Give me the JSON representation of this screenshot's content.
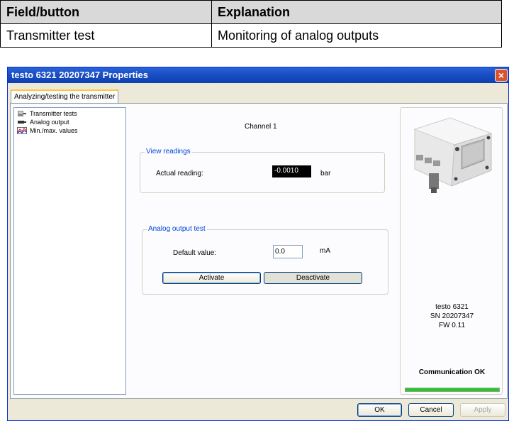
{
  "doc_table": {
    "header": {
      "col1": "Field/button",
      "col2": "Explanation"
    },
    "row": {
      "col1": "Transmitter test",
      "col2": "Monitoring of analog outputs"
    }
  },
  "window": {
    "title": "testo 6321  20207347 Properties",
    "close_glyph": "×",
    "tab_label": "Analyzing/testing the transmitter"
  },
  "tree": {
    "items": [
      {
        "label": "Transmitter tests",
        "icon": "transmitter-icon"
      },
      {
        "label": "Analog output",
        "icon": "plug-icon"
      },
      {
        "label": "Min./max. values",
        "icon": "graph-icon"
      }
    ]
  },
  "channel_label": "Channel 1",
  "view_readings": {
    "legend": "View readings",
    "actual_label": "Actual reading:",
    "value": "-0.0010",
    "unit": "bar"
  },
  "analog_test": {
    "legend": "Analog output test",
    "default_label": "Default value:",
    "default_value": "0.0",
    "unit": "mA",
    "activate_label": "Activate",
    "deactivate_label": "Deactivate"
  },
  "device": {
    "name": "testo 6321",
    "serial": "SN 20207347",
    "firmware": "FW  0.11",
    "status": "Communication OK",
    "status_color": "#22cc22"
  },
  "footer": {
    "ok_label": "OK",
    "cancel_label": "Cancel",
    "apply_label": "Apply"
  }
}
